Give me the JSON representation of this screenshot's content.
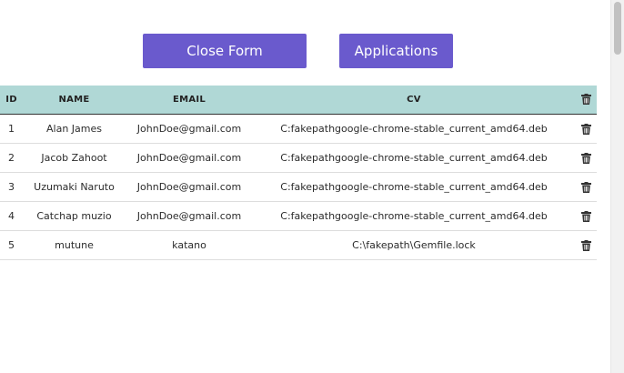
{
  "actions": {
    "close_form_label": "Close Form",
    "applications_label": "Applications"
  },
  "table": {
    "headers": {
      "id": "ID",
      "name": "NAME",
      "email": "EMAIL",
      "cv": "CV"
    },
    "delete_icon": "trash-icon",
    "rows": [
      {
        "id": "1",
        "name": "Alan James",
        "email": "JohnDoe@gmail.com",
        "cv": "C:fakepathgoogle-chrome-stable_current_amd64.deb"
      },
      {
        "id": "2",
        "name": "Jacob Zahoot",
        "email": "JohnDoe@gmail.com",
        "cv": "C:fakepathgoogle-chrome-stable_current_amd64.deb"
      },
      {
        "id": "3",
        "name": "Uzumaki Naruto",
        "email": "JohnDoe@gmail.com",
        "cv": "C:fakepathgoogle-chrome-stable_current_amd64.deb"
      },
      {
        "id": "4",
        "name": "Catchap muzio",
        "email": "JohnDoe@gmail.com",
        "cv": "C:fakepathgoogle-chrome-stable_current_amd64.deb"
      },
      {
        "id": "5",
        "name": "mutune",
        "email": "katano",
        "cv": "C:\\fakepath\\Gemfile.lock"
      }
    ]
  },
  "colors": {
    "button_bg": "#6a5acd",
    "header_bg": "#b0d8d6"
  }
}
